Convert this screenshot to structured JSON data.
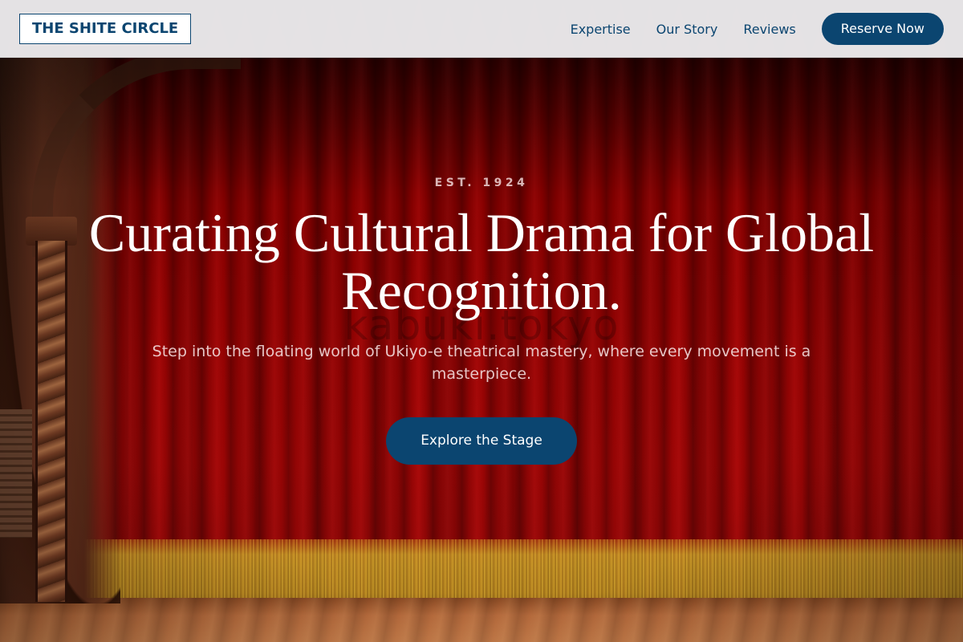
{
  "header": {
    "logo_text": "THE SHITE CIRCLE",
    "nav_links": [
      "Expertise",
      "Our Story",
      "Reviews"
    ],
    "cta_label": "Reserve Now"
  },
  "hero": {
    "eyebrow": "EST. 1924",
    "headline": "Curating Cultural Drama for Global Recognition.",
    "subtext": "Step into the floating world of Ukiyo-e theatrical mastery, where every movement is a masterpiece.",
    "cta_label": "Explore the Stage",
    "watermark": "kabuki.tokyo"
  },
  "colors": {
    "brand": "#0b4570",
    "header_bg": "#ebe9eb",
    "curtain": "#9c0303",
    "button_text": "#ffffff"
  }
}
